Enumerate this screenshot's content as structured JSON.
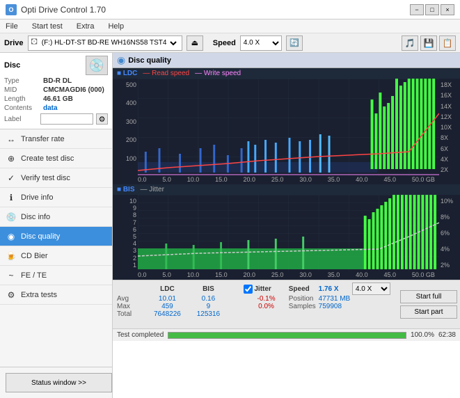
{
  "titlebar": {
    "title": "Opti Drive Control 1.70",
    "min_label": "−",
    "max_label": "□",
    "close_label": "×"
  },
  "menubar": {
    "items": [
      "File",
      "Start test",
      "Extra",
      "Help"
    ]
  },
  "drive_bar": {
    "label": "Drive",
    "drive_value": "(F:)  HL-DT-ST BD-RE  WH16NS58 TST4",
    "speed_label": "Speed",
    "speed_value": "4.0 X"
  },
  "disc": {
    "title": "Disc",
    "type_label": "Type",
    "type_value": "BD-R DL",
    "mid_label": "MID",
    "mid_value": "CMCMAGDI6 (000)",
    "length_label": "Length",
    "length_value": "46.61 GB",
    "contents_label": "Contents",
    "contents_value": "data",
    "label_label": "Label",
    "label_value": ""
  },
  "nav": {
    "items": [
      {
        "id": "transfer-rate",
        "label": "Transfer rate",
        "icon": "↔"
      },
      {
        "id": "create-test-disc",
        "label": "Create test disc",
        "icon": "⊕"
      },
      {
        "id": "verify-test-disc",
        "label": "Verify test disc",
        "icon": "✓"
      },
      {
        "id": "drive-info",
        "label": "Drive info",
        "icon": "ℹ"
      },
      {
        "id": "disc-info",
        "label": "Disc info",
        "icon": "💿"
      },
      {
        "id": "disc-quality",
        "label": "Disc quality",
        "icon": "◉",
        "active": true
      },
      {
        "id": "cd-bier",
        "label": "CD Bier",
        "icon": "🍺"
      },
      {
        "id": "fe-te",
        "label": "FE / TE",
        "icon": "~"
      },
      {
        "id": "extra-tests",
        "label": "Extra tests",
        "icon": "⚙"
      }
    ],
    "status_btn": "Status window >>"
  },
  "chart": {
    "title": "Disc quality",
    "legend_ldc": "LDC",
    "legend_read": "Read speed",
    "legend_write": "Write speed",
    "legend_bis": "BIS",
    "legend_jitter": "Jitter",
    "upper_y_max": 500,
    "upper_y_labels": [
      500,
      400,
      300,
      200,
      100
    ],
    "upper_x_labels": [
      0.0,
      5.0,
      10.0,
      15.0,
      20.0,
      25.0,
      30.0,
      35.0,
      40.0,
      45.0,
      "50.0 GB"
    ],
    "right_y_labels": [
      "18X",
      "16X",
      "14X",
      "12X",
      "10X",
      "8X",
      "6X",
      "4X",
      "2X"
    ],
    "lower_y_max": 10,
    "lower_y_labels": [
      10,
      9,
      8,
      7,
      6,
      5,
      4,
      3,
      2,
      1
    ],
    "lower_x_labels": [
      0.0,
      5.0,
      10.0,
      15.0,
      20.0,
      25.0,
      30.0,
      35.0,
      40.0,
      45.0,
      "50.0 GB"
    ],
    "lower_right_labels": [
      "10%",
      "8%",
      "6%",
      "4%",
      "2%"
    ]
  },
  "stats": {
    "ldc_label": "LDC",
    "bis_label": "BIS",
    "jitter_label": "Jitter",
    "speed_label": "Speed",
    "speed_value": "1.76 X",
    "speed_select": "4.0 X",
    "position_label": "Position",
    "position_value": "47731 MB",
    "samples_label": "Samples",
    "samples_value": "759908",
    "avg_label": "Avg",
    "avg_ldc": "10.01",
    "avg_bis": "0.16",
    "avg_jitter": "-0.1%",
    "max_label": "Max",
    "max_ldc": "459",
    "max_bis": "9",
    "max_jitter": "0.0%",
    "total_label": "Total",
    "total_ldc": "7648226",
    "total_bis": "125316",
    "start_full_label": "Start full",
    "start_part_label": "Start part",
    "jitter_checked": true
  },
  "progress": {
    "status_text": "Test completed",
    "percent": 100,
    "percent_label": "100.0%",
    "time_label": "62:38"
  }
}
